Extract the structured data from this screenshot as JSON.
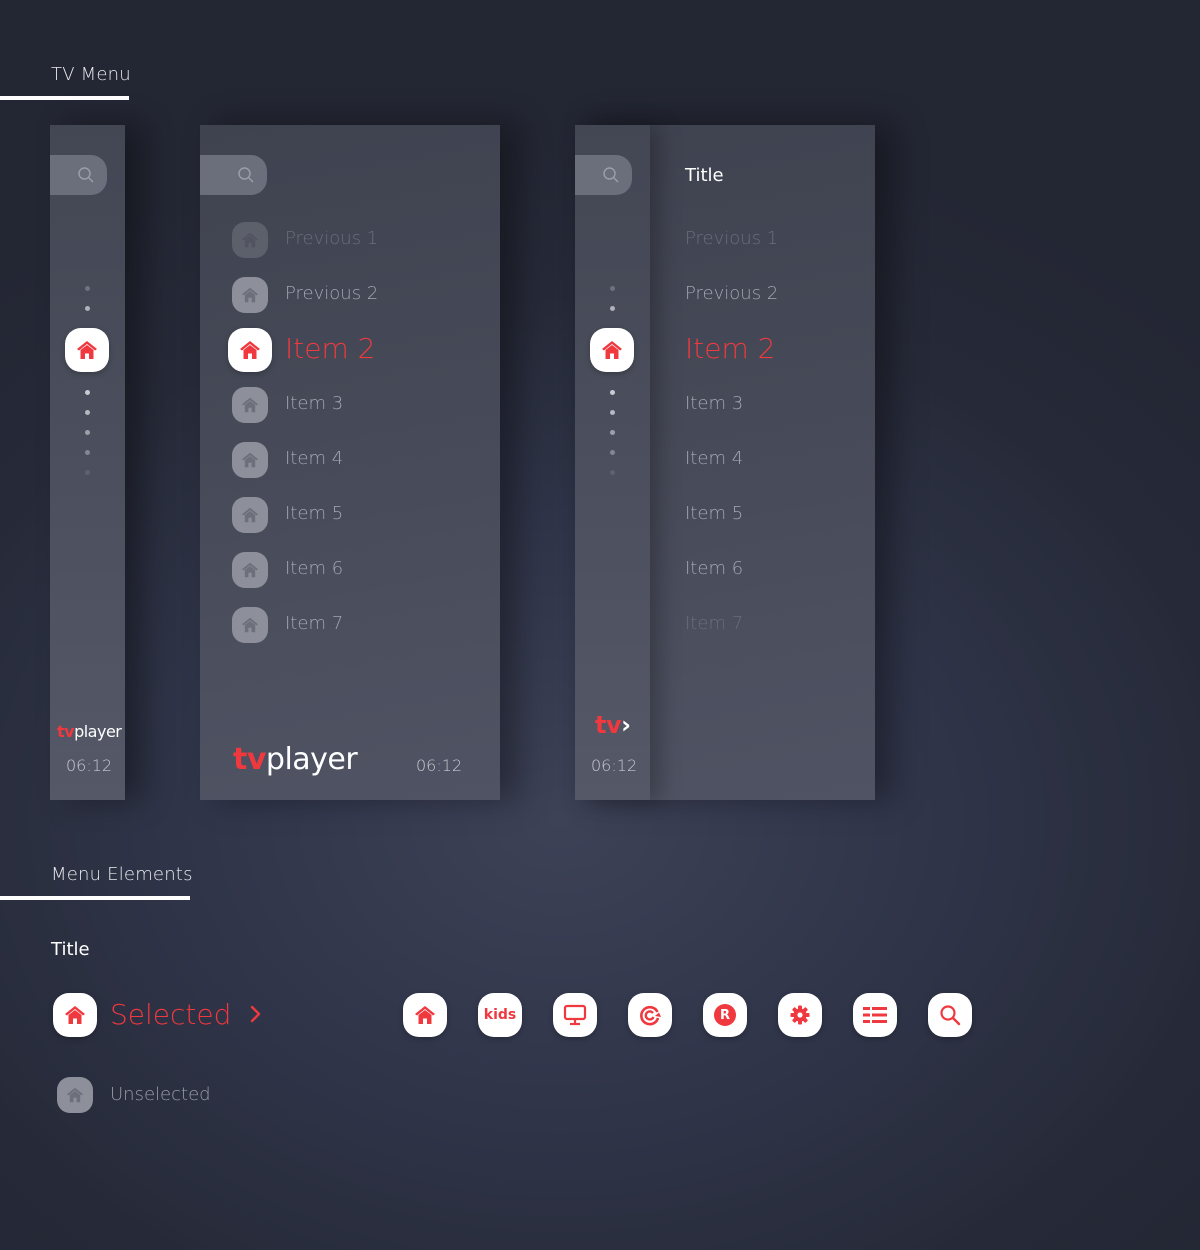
{
  "sections": {
    "tv_menu": "TV Menu",
    "menu_elements": "Menu Elements"
  },
  "colors": {
    "accent": "#f0383f",
    "panel": "#4a4f5e",
    "background": "#262a36",
    "muted_text": "#a3a6b0"
  },
  "collapsed_menu": {
    "search_icon": "search-icon",
    "selected_icon": "home-icon",
    "logo_tv": "tv",
    "logo_player": "player",
    "clock": "06:12"
  },
  "expanded_menu": {
    "items": [
      {
        "label": "Previous 1",
        "state": "faint",
        "icon": "home-icon"
      },
      {
        "label": "Previous 2",
        "state": "normal",
        "icon": "home-icon"
      },
      {
        "label": "Item 2",
        "state": "selected",
        "icon": "home-icon"
      },
      {
        "label": "Item 3",
        "state": "normal",
        "icon": "home-icon"
      },
      {
        "label": "Item 4",
        "state": "normal",
        "icon": "home-icon"
      },
      {
        "label": "Item 5",
        "state": "normal",
        "icon": "home-icon"
      },
      {
        "label": "Item 6",
        "state": "normal",
        "icon": "home-icon"
      },
      {
        "label": "Item 7",
        "state": "normal",
        "icon": "home-icon"
      }
    ],
    "logo_tv": "tv",
    "logo_player": "player",
    "clock": "06:12"
  },
  "split_menu": {
    "title": "Title",
    "items": [
      {
        "label": "Previous 1",
        "state": "faint"
      },
      {
        "label": "Previous 2",
        "state": "normal"
      },
      {
        "label": "Item 2",
        "state": "selected"
      },
      {
        "label": "Item 3",
        "state": "normal"
      },
      {
        "label": "Item 4",
        "state": "normal"
      },
      {
        "label": "Item 5",
        "state": "normal"
      },
      {
        "label": "Item 6",
        "state": "normal"
      },
      {
        "label": "Item 7",
        "state": "faint"
      }
    ],
    "logo_tv": "tv",
    "logo_arrow": "›",
    "clock": "06:12"
  },
  "menu_elements": {
    "title": "Title",
    "selected_label": "Selected",
    "unselected_label": "Unselected",
    "icons": [
      "home-icon",
      "kids-icon",
      "tv-screen-icon",
      "catchup-icon",
      "radio-icon",
      "settings-icon",
      "list-icon",
      "search-icon"
    ],
    "kids_text": "kids",
    "radio_text": "R"
  }
}
